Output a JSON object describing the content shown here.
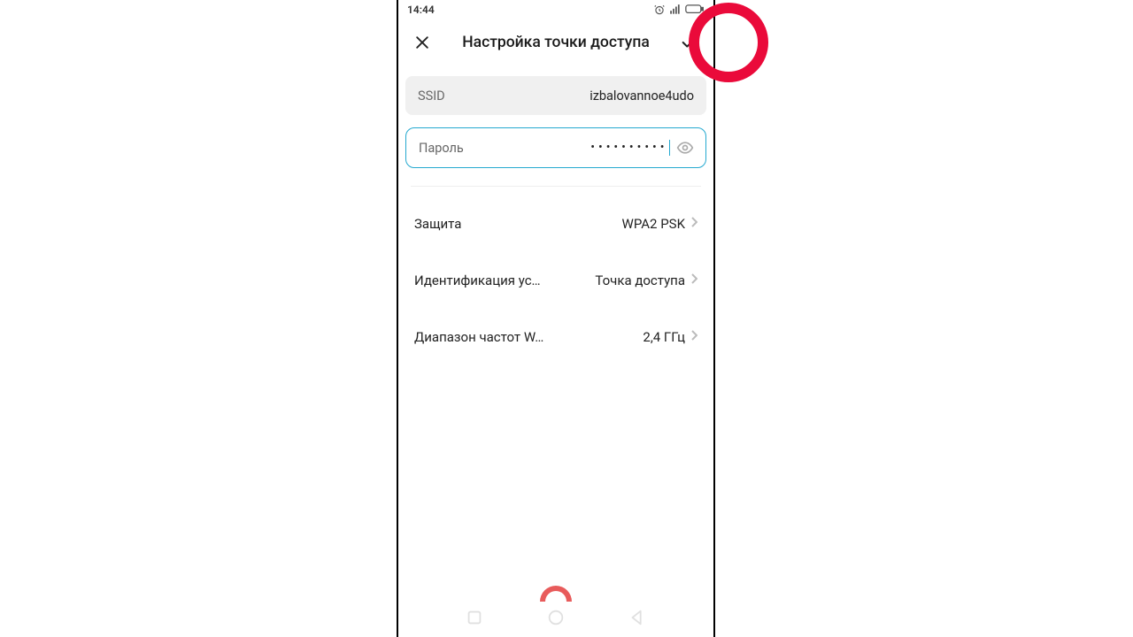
{
  "statusbar": {
    "time": "14:44"
  },
  "header": {
    "title": "Настройка точки доступа"
  },
  "ssid": {
    "label": "SSID",
    "value": "izbalovannoe4udo"
  },
  "password": {
    "label": "Пароль",
    "masked": "••••••••••"
  },
  "rows": {
    "security": {
      "label": "Защита",
      "value": "WPA2 PSK"
    },
    "device_id": {
      "label": "Идентификация ус…",
      "value": "Точка доступа"
    },
    "band": {
      "label": "Диапазон частот W…",
      "value": "2,4 ГГц"
    }
  }
}
